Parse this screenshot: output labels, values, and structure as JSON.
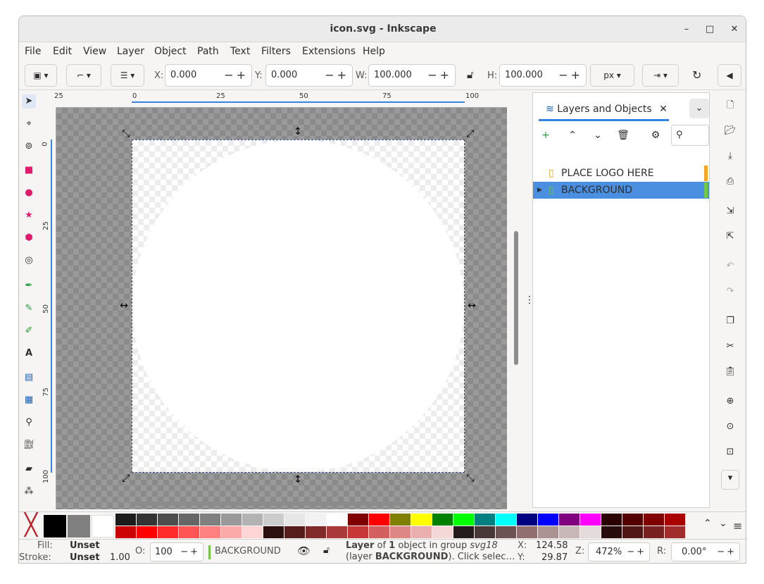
{
  "window": {
    "title": "icon.svg - Inkscape",
    "minimize": "–",
    "maximize": "□",
    "close": "✕"
  },
  "menu": [
    "File",
    "Edit",
    "View",
    "Layer",
    "Object",
    "Path",
    "Text",
    "Filters",
    "Extensions",
    "Help"
  ],
  "toolbar": {
    "x_label": "X:",
    "x_value": "0.000",
    "y_label": "Y:",
    "y_value": "0.000",
    "w_label": "W:",
    "w_value": "100.000",
    "h_label": "H:",
    "h_value": "100.000",
    "unit": "px"
  },
  "ruler_top": [
    "25",
    "0",
    "25",
    "50",
    "75",
    "100"
  ],
  "ruler_left": [
    "0",
    "25",
    "50",
    "75",
    "100"
  ],
  "panel": {
    "tab_label": "Layers and Objects",
    "rows": [
      {
        "label": "PLACE LOGO HERE",
        "color": "#f6a623",
        "selected": false
      },
      {
        "label": "BACKGROUND",
        "color": "#73c648",
        "selected": true
      }
    ]
  },
  "palette": {
    "top": [
      "#1c1c1c",
      "#333333",
      "#4d4d4d",
      "#666666",
      "#808080",
      "#999999",
      "#b3b3b3",
      "#cccccc",
      "#e6e6e6",
      "#f2f2f2",
      "#ffffff",
      "#800000",
      "#ff0000",
      "#808000",
      "#ffff00",
      "#008000",
      "#00ff00",
      "#008080",
      "#00ffff",
      "#000080",
      "#0000ff",
      "#800080",
      "#ff00ff",
      "#2b0000",
      "#550000",
      "#800000",
      "#aa0000"
    ],
    "bottom": [
      "#cc0000",
      "#ff0000",
      "#ff2a2a",
      "#ff5555",
      "#ff8080",
      "#ffaaaa",
      "#ffd5d5",
      "#2b0e0e",
      "#551c1c",
      "#802a2a",
      "#aa3939",
      "#c83737",
      "#d35f5f",
      "#de8787",
      "#e9afaf",
      "#f4d7d7",
      "#241c1c",
      "#483737",
      "#6c5353",
      "#916f6f",
      "#ac9393",
      "#c8b7b7",
      "#e3dbdb",
      "#280b0b",
      "#501616",
      "#782121",
      "#a02c2c"
    ]
  },
  "status": {
    "fill_label": "Fill:",
    "fill_value": "Unset",
    "stroke_label": "Stroke:",
    "stroke_value": "Unset",
    "stroke_width": "1.00",
    "opacity_label": "O:",
    "opacity_value": "100",
    "layer_name": "BACKGROUND",
    "message_line1_a": "Layer",
    "message_line1_b": " of ",
    "message_line1_c": "1",
    "message_line1_d": " object in group ",
    "message_line1_e": "svg18",
    "message_line2_a": "(layer ",
    "message_line2_b": "BACKGROUND",
    "message_line2_c": "). Click selec…",
    "cx_label": "X:",
    "cx_value": "124.58",
    "cy_label": "Y:",
    "cy_value": "29.87",
    "zoom_label": "Z:",
    "zoom_value": "472%",
    "rot_label": "R:",
    "rot_value": "0.00°"
  }
}
